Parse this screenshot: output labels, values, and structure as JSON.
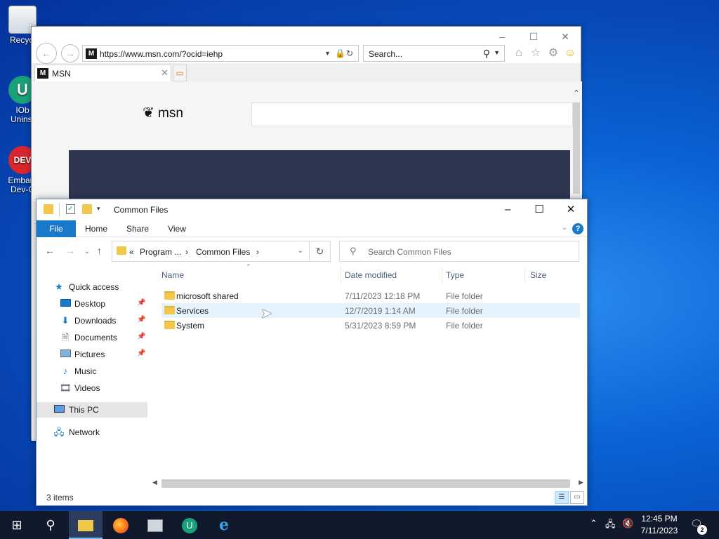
{
  "desktop": {
    "icons": [
      {
        "label": "Recycl",
        "icon": "recycle-bin-icon"
      },
      {
        "label": "IOb\nUninst",
        "icon": "iobit-uninstaller-icon"
      },
      {
        "label": "Embarc\nDev-C",
        "icon": "embarcadero-devcpp-icon"
      }
    ]
  },
  "ie": {
    "address": "https://www.msn.com/?ocid=iehp",
    "search_placeholder": "Search...",
    "tab_label": "MSN",
    "favicon": "M",
    "msn_logo_text": "msn",
    "window_controls": {
      "minimize": "–",
      "maximize": "☐",
      "close": "✕"
    }
  },
  "explorer": {
    "title": "Common Files",
    "ribbon": {
      "file": "File",
      "home": "Home",
      "share": "Share",
      "view": "View",
      "help": "?"
    },
    "breadcrumb": {
      "overflow": "«",
      "part1": "Program ...",
      "sep1": "›",
      "part2": "Common Files",
      "sep2": "›"
    },
    "search_placeholder": "Search Common Files",
    "columns": {
      "name": "Name",
      "date": "Date modified",
      "type": "Type",
      "size": "Size"
    },
    "files": [
      {
        "name": "microsoft shared",
        "date": "7/11/2023 12:18 PM",
        "type": "File folder",
        "size": ""
      },
      {
        "name": "Services",
        "date": "12/7/2019 1:14 AM",
        "type": "File folder",
        "size": ""
      },
      {
        "name": "System",
        "date": "5/31/2023 8:59 PM",
        "type": "File folder",
        "size": ""
      }
    ],
    "sidebar": {
      "quick_access": "Quick access",
      "desktop": "Desktop",
      "downloads": "Downloads",
      "documents": "Documents",
      "pictures": "Pictures",
      "music": "Music",
      "videos": "Videos",
      "this_pc": "This PC",
      "network": "Network"
    },
    "status": "3 items",
    "window_controls": {
      "minimize": "–",
      "maximize": "☐",
      "close": "✕"
    }
  },
  "taskbar": {
    "time": "12:45 PM",
    "date": "7/11/2023",
    "notification_count": "2"
  },
  "colors": {
    "accent": "#1979ca",
    "taskbar": "#101a2c",
    "folder": "#f2c84b",
    "hover_row": "#e5f3ff"
  }
}
